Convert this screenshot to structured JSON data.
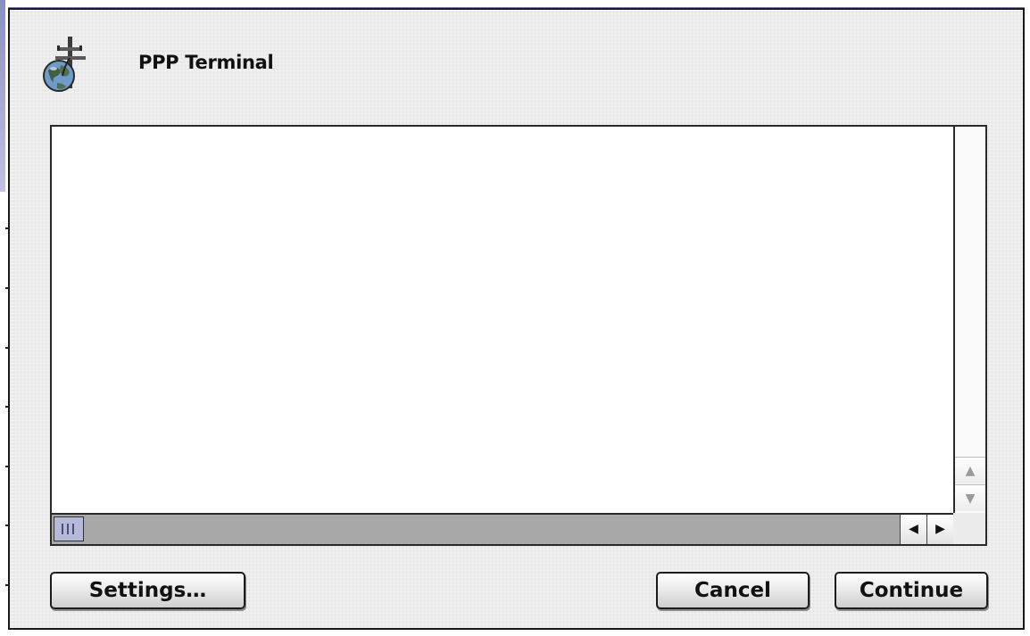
{
  "dialog": {
    "title": "PPP Terminal",
    "icon": "globe-connection-icon"
  },
  "terminal": {
    "content": ""
  },
  "scrollbars": {
    "vertical_up_icon": "▲",
    "vertical_down_icon": "▼",
    "horizontal_left_icon": "◀",
    "horizontal_right_icon": "▶"
  },
  "buttons": {
    "settings": "Settings…",
    "cancel": "Cancel",
    "continue": "Continue"
  },
  "colors": {
    "window_bg": "#ececec",
    "scroll_thumb": "#b6bad9",
    "scroll_track": "#a8a8a8"
  }
}
